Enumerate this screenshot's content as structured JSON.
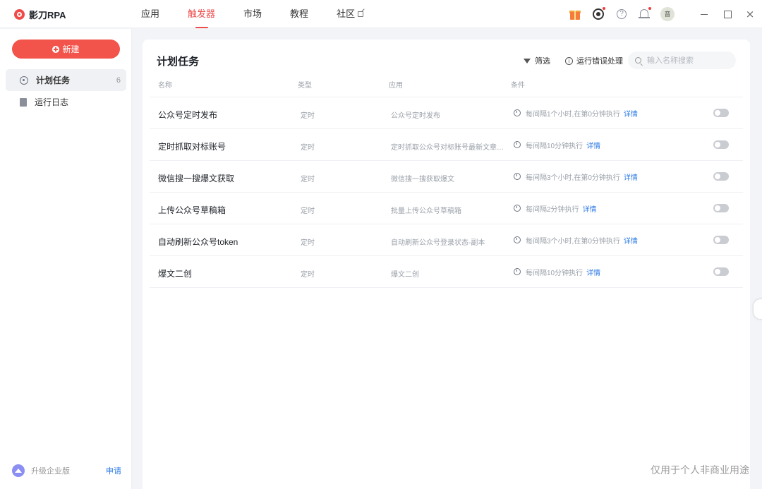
{
  "app": {
    "name": "影刀RPA",
    "brand_color": "#ef4b4b"
  },
  "nav": {
    "tabs": [
      {
        "label": "应用"
      },
      {
        "label": "触发器"
      },
      {
        "label": "市场"
      },
      {
        "label": "教程"
      },
      {
        "label": "社区"
      }
    ],
    "active_tab": "触发器"
  },
  "top_icons": {
    "gift": "gift-icon",
    "view": "eye-icon",
    "help": "help-icon",
    "notifications": "bell-icon",
    "avatar_text": "音"
  },
  "window": {
    "minimize": "minimize",
    "maximize": "maximize",
    "close": "×"
  },
  "sidebar": {
    "new_label": "新建",
    "items": [
      {
        "label": "计划任务",
        "count": "6",
        "icon": "target-icon"
      },
      {
        "label": "运行日志",
        "icon": "document-icon"
      }
    ],
    "upgrade_label": "升级企业版",
    "apply_label": "申请"
  },
  "main": {
    "title": "计划任务",
    "filter_label": "筛选",
    "error_label": "运行错误处理",
    "search": {
      "placeholder": "输入名称搜索",
      "value": ""
    },
    "columns": [
      "名称",
      "类型",
      "应用",
      "条件"
    ],
    "rows": [
      {
        "name": "公众号定时发布",
        "type": "定时",
        "app": "公众号定时发布",
        "condition": "每间隔1个小时,在第0分钟执行",
        "detail": "详情",
        "enabled": false
      },
      {
        "name": "定时抓取对标账号",
        "type": "定时",
        "app": "定时抓取公众号对标账号最新文章到...",
        "condition": "每间隔10分钟执行",
        "detail": "详情",
        "enabled": false
      },
      {
        "name": "微信搜一搜爆文获取",
        "type": "定时",
        "app": "微信搜一搜获取爆文",
        "condition": "每间隔3个小时,在第0分钟执行",
        "detail": "详情",
        "enabled": false
      },
      {
        "name": "上传公众号草稿箱",
        "type": "定时",
        "app": "批量上传公众号草稿箱",
        "condition": "每间隔2分钟执行",
        "detail": "详情",
        "enabled": false
      },
      {
        "name": "自动刷新公众号token",
        "type": "定时",
        "app": "自动刷新公众号登录状态-副本",
        "condition": "每间隔3个小时,在第0分钟执行",
        "detail": "详情",
        "enabled": false
      },
      {
        "name": "爆文二创",
        "type": "定时",
        "app": "爆文二创",
        "condition": "每间隔10分钟执行",
        "detail": "详情",
        "enabled": false
      }
    ]
  },
  "watermark": "仅用于个人非商业用途"
}
